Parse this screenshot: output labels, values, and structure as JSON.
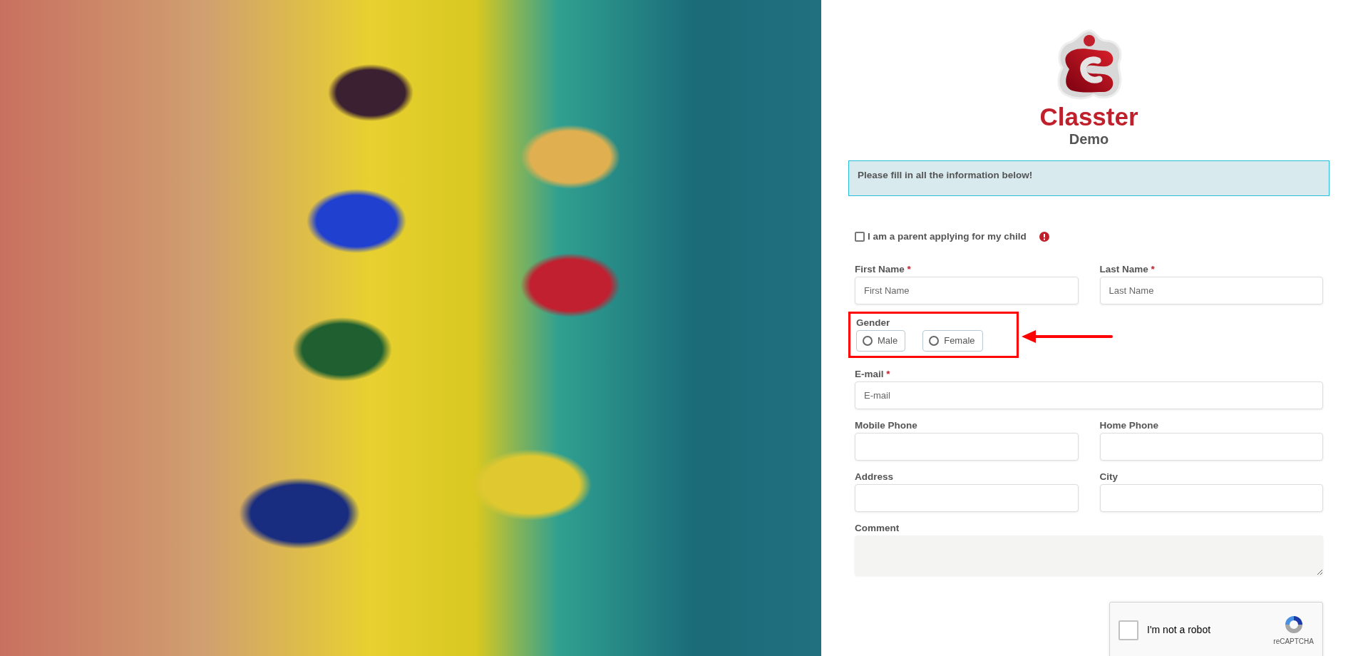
{
  "logo": {
    "name": "Classter",
    "subtitle": "Demo"
  },
  "notice": "Please fill in all the information below!",
  "parent_checkbox": {
    "label": "I am a parent applying for my child",
    "checked": false
  },
  "rows": [
    [
      {
        "kind": "text",
        "label": "First Name",
        "required_mark": "*",
        "placeholder": "First Name"
      },
      {
        "kind": "text",
        "label": "Last Name",
        "required_mark": "*",
        "placeholder": "Last Name"
      }
    ],
    [
      {
        "kind": "radio",
        "label": "Gender",
        "highlighted": true,
        "options": [
          {
            "label": "Male",
            "selected": false
          },
          {
            "label": "Female",
            "selected": false
          }
        ]
      }
    ],
    [
      {
        "kind": "text",
        "label": "E-mail",
        "required_mark": "*",
        "placeholder": "E-mail"
      }
    ],
    [
      {
        "kind": "text",
        "label": "Mobile Phone"
      },
      {
        "kind": "text",
        "label": "Home Phone"
      }
    ],
    [
      {
        "kind": "text",
        "label": "Address"
      },
      {
        "kind": "text",
        "label": "City"
      }
    ],
    [
      {
        "kind": "textarea",
        "label": "Comment"
      }
    ]
  ],
  "captcha": {
    "label": "I'm not a robot",
    "brand": "reCAPTCHA",
    "checked": false
  }
}
